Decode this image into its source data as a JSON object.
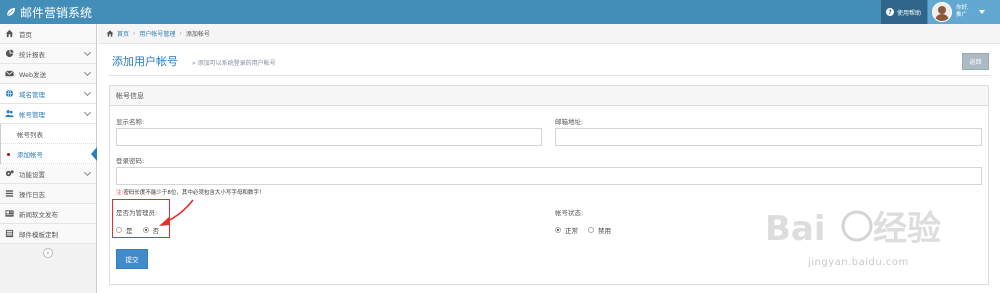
{
  "app": {
    "title": "邮件营销系统"
  },
  "topbar": {
    "help_label": "使用帮助",
    "user_line1": "你好,",
    "user_line2": "推广"
  },
  "sidebar": {
    "items": [
      {
        "label": "首页",
        "icon": "home-icon"
      },
      {
        "label": "统计报表",
        "icon": "pie-chart-icon"
      },
      {
        "label": "Web发送",
        "icon": "envelope-icon"
      },
      {
        "label": "域名管理",
        "icon": "globe-icon"
      },
      {
        "label": "帐号管理",
        "icon": "users-icon"
      },
      {
        "label": "功能设置",
        "icon": "cogs-icon"
      },
      {
        "label": "操作日志",
        "icon": "list-icon"
      },
      {
        "label": "新闻软文发布",
        "icon": "news-icon"
      },
      {
        "label": "邮件模板定制",
        "icon": "template-icon"
      }
    ],
    "sub_items": [
      {
        "label": "帐号列表"
      },
      {
        "label": "添加帐号"
      }
    ],
    "collapse_glyph": "«"
  },
  "breadcrumb": {
    "home": "首页",
    "parent": "用户帐号管理",
    "current": "添加帐号"
  },
  "page": {
    "title": "添加用户帐号",
    "subtitle": "» 添加可以系统登录的用户帐号",
    "back_label": "返回"
  },
  "form": {
    "panel_title": "帐号信息",
    "display_name_label": "显示名称:",
    "display_name_value": "",
    "email_label": "邮箱地址:",
    "email_value": "",
    "password_label": "登录密码:",
    "password_value": "",
    "note_prefix": "注:",
    "note_text": "密码长度不能少于8位，其中必须包含大小写字母和数字！",
    "is_admin_label": "是否为管理员:",
    "is_admin_options": [
      "是",
      "否"
    ],
    "is_admin_selected": "否",
    "status_label": "帐号状态:",
    "status_options": [
      "正常",
      "禁用"
    ],
    "status_selected": "正常",
    "submit_label": "提交"
  },
  "watermark": {
    "text": "jingyan.baidu.com"
  },
  "colors": {
    "topbar": "#438eb9",
    "accent": "#2b7dbc",
    "button": "#428bca",
    "highlight": "#e03030"
  }
}
